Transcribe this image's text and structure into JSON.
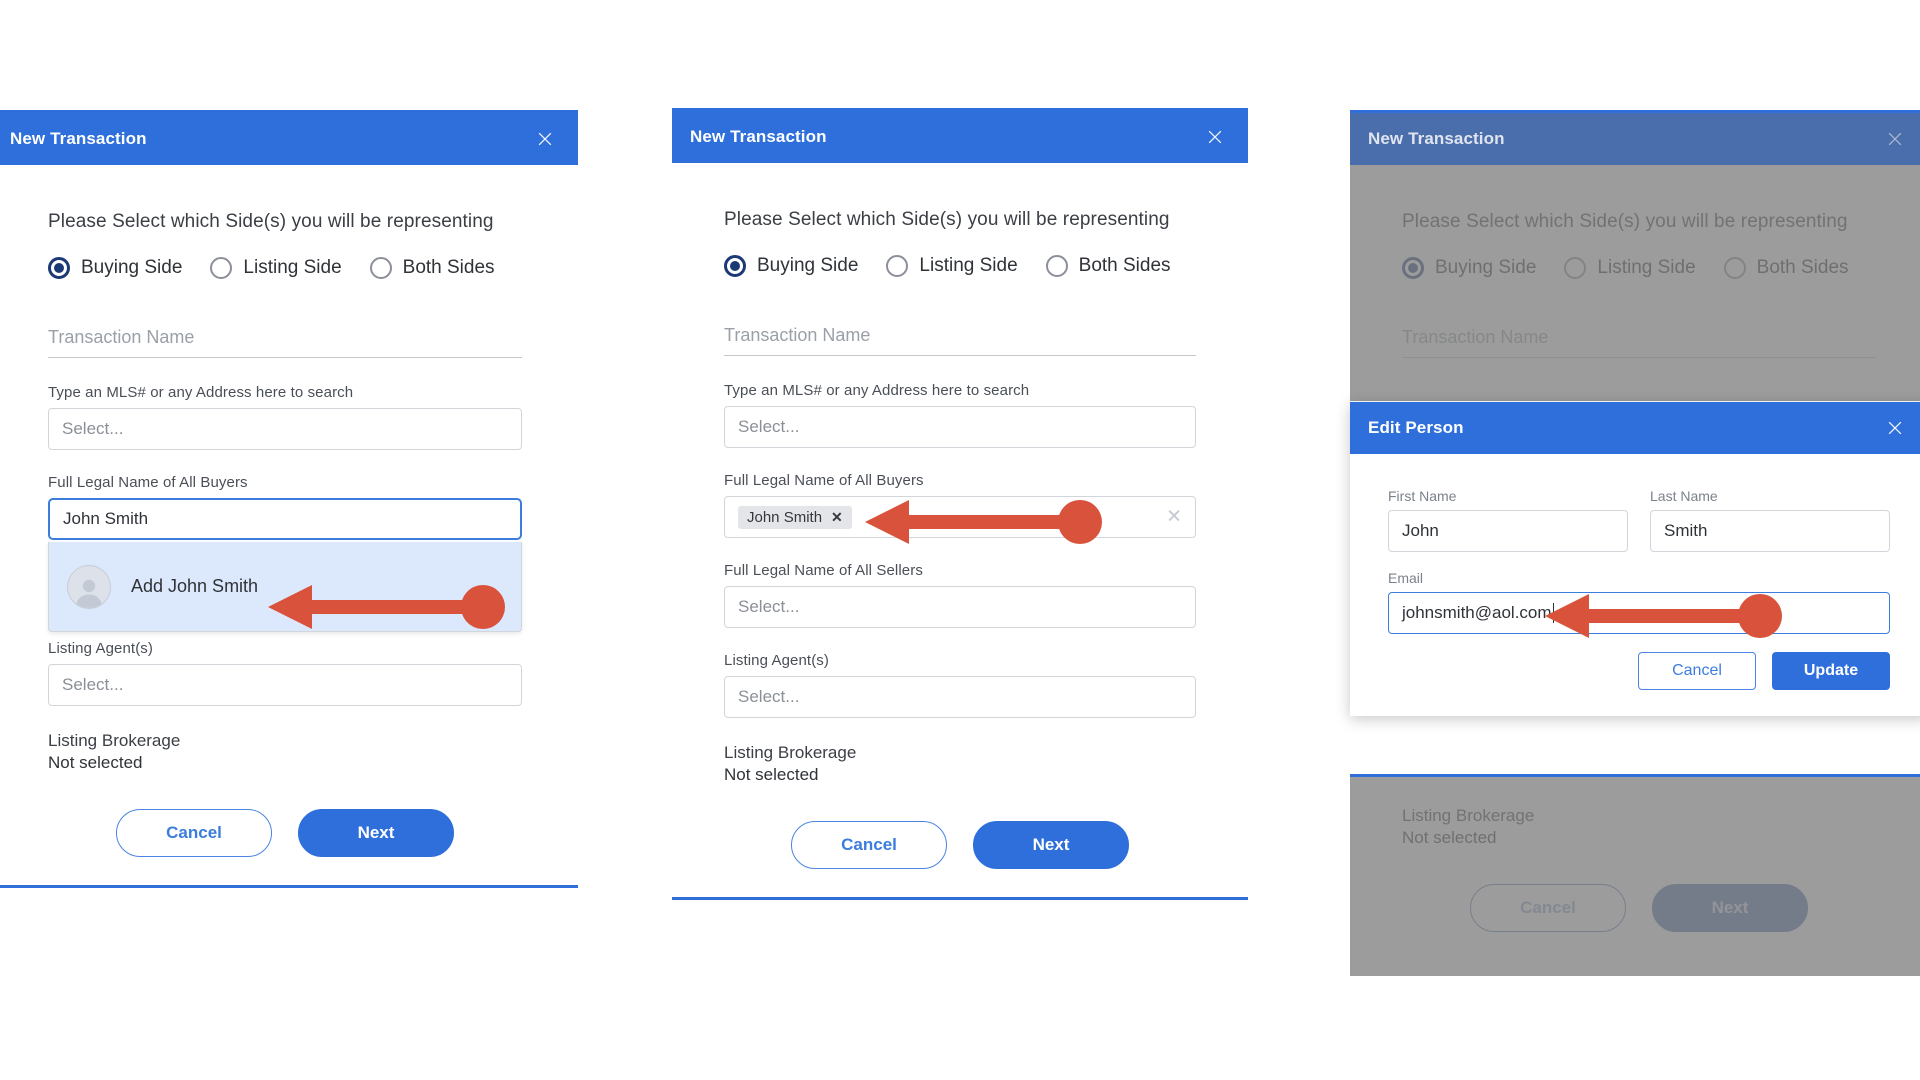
{
  "accent": {
    "blue": "#2f6fdb",
    "navy": "#1b3a75",
    "arrow_red": "#d9523c",
    "suggest_bg": "#dce8fb",
    "veil_grey": "#808080"
  },
  "dialog": {
    "title": "New Transaction",
    "close_icon": "close-icon",
    "prompt": "Please Select which Side(s) you will be representing",
    "sides": [
      {
        "label": "Buying Side",
        "selected": true
      },
      {
        "label": "Listing Side",
        "selected": false
      },
      {
        "label": "Both Sides",
        "selected": false
      }
    ],
    "transaction_name": {
      "label": "Transaction Name",
      "placeholder": "Transaction Name",
      "value": ""
    },
    "mls": {
      "label": "Type an MLS# or any Address here to search",
      "placeholder": "Select...",
      "value": ""
    },
    "buyers": {
      "label": "Full Legal Name of All Buyers",
      "placeholder": "Select...",
      "typed_value": "John Smith",
      "chip_value": "John Smith",
      "chip_remove_icon": "chip-remove-icon",
      "clear_icon": "clear-icon"
    },
    "sellers": {
      "label": "Full Legal Name of All Sellers",
      "placeholder": "Select...",
      "value": ""
    },
    "listing_agents": {
      "label": "Listing Agent(s)",
      "placeholder": "Select...",
      "value": ""
    },
    "listing_brokerage": {
      "label": "Listing Brokerage",
      "value": "Not selected"
    },
    "suggestion": {
      "label": "Add John Smith",
      "avatar_icon": "person-avatar-icon"
    },
    "buttons": {
      "cancel": "Cancel",
      "next": "Next"
    }
  },
  "edit_person": {
    "title": "Edit Person",
    "close_icon": "close-icon",
    "first_name": {
      "label": "First Name",
      "value": "John"
    },
    "last_name": {
      "label": "Last Name",
      "value": "Smith"
    },
    "email": {
      "label": "Email",
      "value": "johnsmith@aol.com"
    },
    "buttons": {
      "cancel": "Cancel",
      "update": "Update"
    }
  },
  "annotations": [
    {
      "name": "arrow-to-add-john-smith",
      "points_to": "Add John Smith suggestion row"
    },
    {
      "name": "arrow-to-john-smith-chip",
      "points_to": "John Smith chip in buyers field"
    },
    {
      "name": "arrow-to-email-field",
      "points_to": "Email input johnsmith@aol.com"
    }
  ]
}
